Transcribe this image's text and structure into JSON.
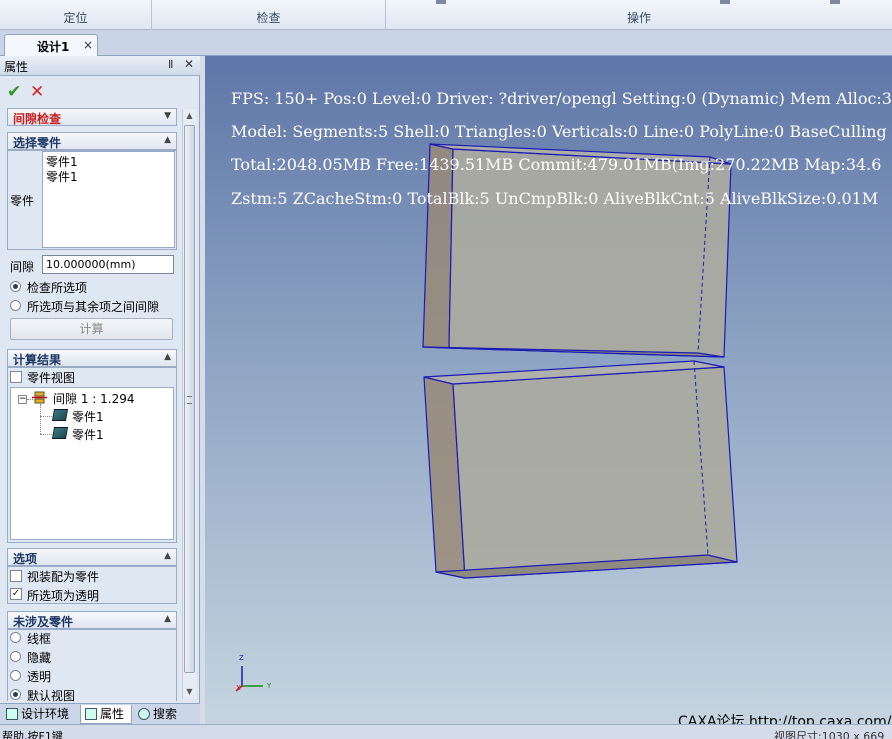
{
  "ribbon": {
    "groups": [
      "定位",
      "检查",
      "操作"
    ]
  },
  "document_tab": {
    "label": "设计1",
    "close": "×"
  },
  "panel": {
    "title": "属性",
    "pin": "Ⅱ",
    "close": "✕",
    "ok_symbol": "✔",
    "cancel_symbol": "✕",
    "command": "间隙检查",
    "select_parts": {
      "header": "选择零件",
      "field_label": "零件",
      "items": [
        "零件1",
        "零件1"
      ]
    },
    "gap": {
      "label": "间隙",
      "value": "10.000000(mm)"
    },
    "mode_options": [
      {
        "label": "检查所选项",
        "selected": true
      },
      {
        "label": "所选项与其余项之间间隙",
        "selected": false
      }
    ],
    "compute_button": "计算",
    "results": {
      "header": "计算结果",
      "part_view": {
        "label": "零件视图",
        "checked": false
      },
      "tree": {
        "root": "间隙 1 : 1.294",
        "children": [
          "零件1",
          "零件1"
        ]
      }
    },
    "options": {
      "header": "选项",
      "items": [
        {
          "label": "视装配为零件",
          "checked": false
        },
        {
          "label": "所选项为透明",
          "checked": true
        }
      ]
    },
    "uninvolved": {
      "header": "未涉及零件",
      "items": [
        {
          "label": "线框",
          "selected": false
        },
        {
          "label": "隐藏",
          "selected": false
        },
        {
          "label": "透明",
          "selected": false
        },
        {
          "label": "默认视图",
          "selected": true
        }
      ]
    },
    "bottom_tabs": [
      "设计环境",
      "属性",
      "搜索"
    ]
  },
  "viewport": {
    "stats": [
      "FPS: 150+ Pos:0 Level:0 Driver: ?driver/opengl Setting:0 (Dynamic) Mem Alloc:3",
      "Model: Segments:5  Shell:0  Triangles:0 Verticals:0 Line:0 PolyLine:0 BaseCulling",
      "Total:2048.05MB  Free:1439.51MB  Commit:479.01MB(Img:270.22MB Map:34.6",
      "Zstm:5  ZCacheStm:0  TotalBlk:5 UnCmpBlk:0 AliveBlkCnt:5 AliveBlkSize:0.01M"
    ],
    "axes": {
      "x": "Y",
      "z": "Z",
      "origin": "X"
    },
    "watermark": "CAXA论坛 http://top.caxa.com/",
    "colors": {
      "edge": "#1a1ab4",
      "face": "#a8a89a",
      "side": "#9a8a78"
    }
  },
  "statusbar": {
    "left": "帮助,按F1键",
    "right": "视图尺寸:1030 x 669"
  }
}
